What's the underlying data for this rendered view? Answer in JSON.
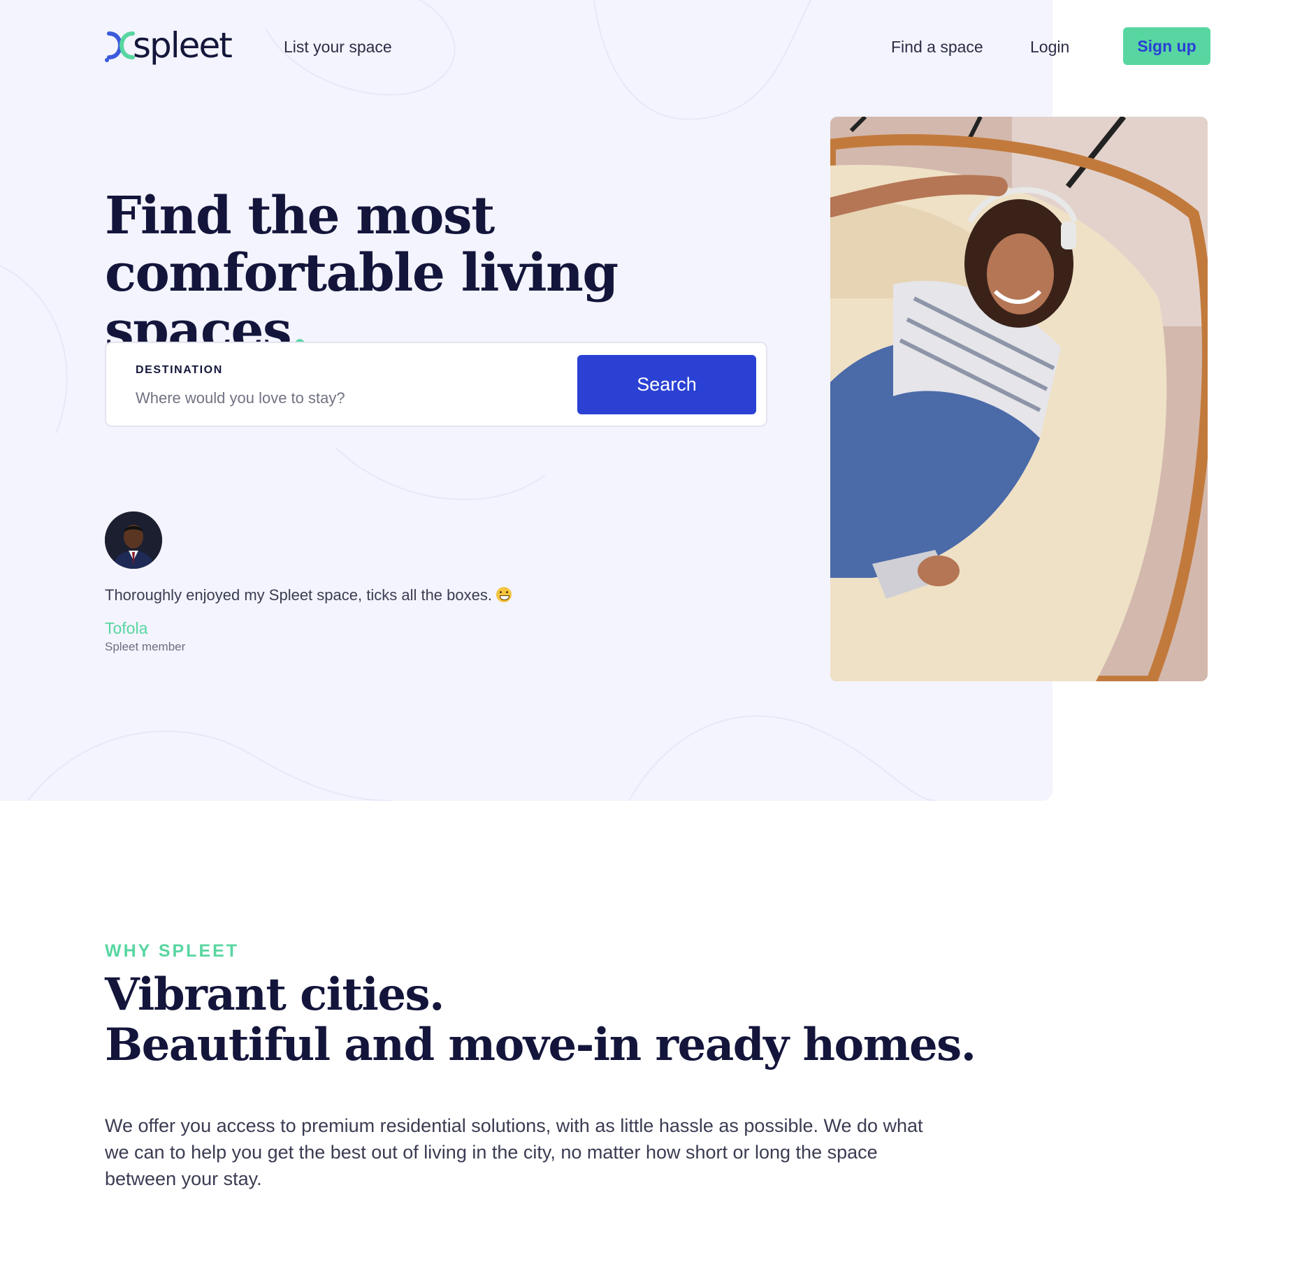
{
  "header": {
    "logo_text": "spleet",
    "nav": {
      "list_space": "List your space",
      "find_space": "Find a space",
      "login": "Login",
      "signup": "Sign up"
    }
  },
  "hero": {
    "headline_line1": "Find the most",
    "headline_line2": "comfortable living spaces",
    "headline_dot": ".",
    "search": {
      "label": "DESTINATION",
      "placeholder": "Where would you love to stay?",
      "value": "",
      "button": "Search"
    },
    "testimonial": {
      "quote": "Thoroughly enjoyed my Spleet space, ticks all the boxes.",
      "emoji": "grinning-face-icon",
      "author": "Tofola",
      "role": "Spleet member"
    }
  },
  "why": {
    "kicker": "WHY SPLEET",
    "title_line1": "Vibrant cities.",
    "title_line2": "Beautiful and move-in ready homes.",
    "body": "We offer you access to premium residential solutions, with as little hassle as possible. We do what we can to help you get the best out of living in the city, no matter how short or long the space between your stay."
  },
  "colors": {
    "accent_green": "#58d6a1",
    "primary_blue": "#2b41d4",
    "navy": "#13153b",
    "hero_bg": "#f3f4fd"
  }
}
